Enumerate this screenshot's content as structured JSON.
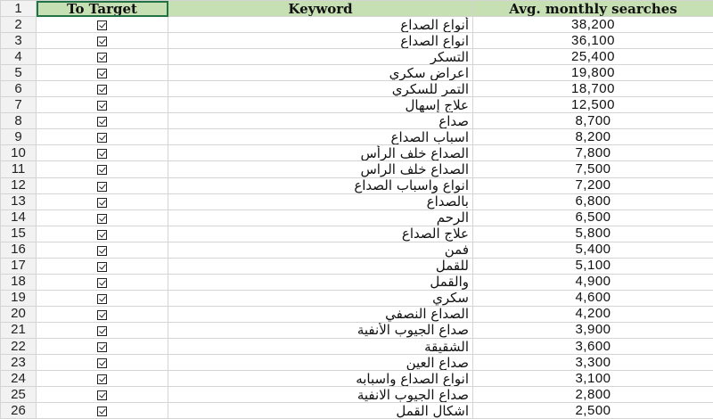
{
  "sheet": {
    "headers": {
      "row_number": "1",
      "target": "To Target",
      "keyword": "Keyword",
      "avg": "Avg. monthly searches"
    },
    "rows": [
      {
        "n": "2",
        "checked": true,
        "keyword": "أنواع الصداع",
        "avg": "38,200"
      },
      {
        "n": "3",
        "checked": true,
        "keyword": "انواع الصداع",
        "avg": "36,100"
      },
      {
        "n": "4",
        "checked": true,
        "keyword": "التسكر",
        "avg": "25,400"
      },
      {
        "n": "5",
        "checked": true,
        "keyword": "اعراض سكري",
        "avg": "19,800"
      },
      {
        "n": "6",
        "checked": true,
        "keyword": "التمر للسكري",
        "avg": "18,700"
      },
      {
        "n": "7",
        "checked": true,
        "keyword": "علاج إسهال",
        "avg": "12,500"
      },
      {
        "n": "8",
        "checked": true,
        "keyword": "صداع",
        "avg": "8,700"
      },
      {
        "n": "9",
        "checked": true,
        "keyword": "اسباب الصداع",
        "avg": "8,200"
      },
      {
        "n": "10",
        "checked": true,
        "keyword": "الصداع خلف الرأس",
        "avg": "7,800"
      },
      {
        "n": "11",
        "checked": true,
        "keyword": "الصداع خلف الراس",
        "avg": "7,500"
      },
      {
        "n": "12",
        "checked": true,
        "keyword": "انواع واسباب الصداع",
        "avg": "7,200"
      },
      {
        "n": "13",
        "checked": true,
        "keyword": "بالصداع",
        "avg": "6,800"
      },
      {
        "n": "14",
        "checked": true,
        "keyword": "الرحم",
        "avg": "6,500"
      },
      {
        "n": "15",
        "checked": true,
        "keyword": "علاج الصداع",
        "avg": "5,800"
      },
      {
        "n": "16",
        "checked": true,
        "keyword": "فمن",
        "avg": "5,400"
      },
      {
        "n": "17",
        "checked": true,
        "keyword": "للقمل",
        "avg": "5,100"
      },
      {
        "n": "18",
        "checked": true,
        "keyword": "والقمل",
        "avg": "4,900"
      },
      {
        "n": "19",
        "checked": true,
        "keyword": "سكري",
        "avg": "4,600"
      },
      {
        "n": "20",
        "checked": true,
        "keyword": "الصداع النصفي",
        "avg": "4,200"
      },
      {
        "n": "21",
        "checked": true,
        "keyword": "صداع الجيوب الأنفية",
        "avg": "3,900"
      },
      {
        "n": "22",
        "checked": true,
        "keyword": "الشقيقة",
        "avg": "3,600"
      },
      {
        "n": "23",
        "checked": true,
        "keyword": "صداع العين",
        "avg": "3,300"
      },
      {
        "n": "24",
        "checked": true,
        "keyword": "انواع الصداع واسبابه",
        "avg": "3,100"
      },
      {
        "n": "25",
        "checked": true,
        "keyword": "صداع الجيوب الانفية",
        "avg": "2,800"
      },
      {
        "n": "26",
        "checked": true,
        "keyword": "اشكال القمل",
        "avg": "2,500"
      }
    ]
  },
  "colors": {
    "header_fill": "#c6e0b4",
    "gridline": "#d4d4d4",
    "selection": "#217346"
  }
}
